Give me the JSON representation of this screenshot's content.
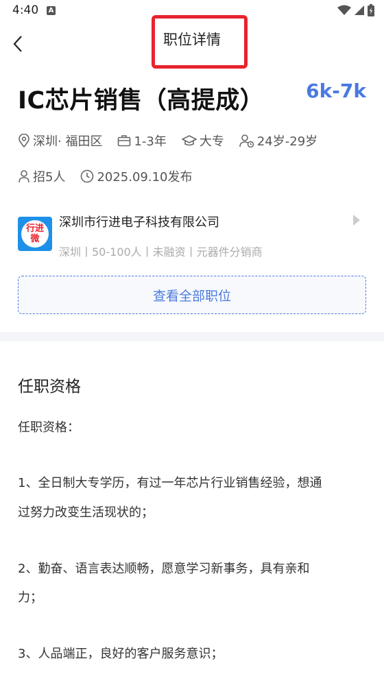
{
  "status": {
    "time": "4:40",
    "notif_letter": "A"
  },
  "nav": {
    "title": "职位详情"
  },
  "job": {
    "title": "IC芯片销售（高提成）",
    "salary": "6k-7k",
    "location": "深圳· 福田区",
    "experience": "1-3年",
    "education": "大专",
    "age": "24岁-29岁",
    "headcount": "招5人",
    "published": "2025.09.10发布"
  },
  "company": {
    "logo_text_1": "行进",
    "logo_text_2": "微",
    "name": "深圳市行进电子科技有限公司",
    "meta": "深圳丨50-100人丨未融资丨元器件分销商"
  },
  "all_jobs_label": "查看全部职位",
  "requirements": {
    "title": "任职资格",
    "lines": [
      "任职资格：",
      "1、全日制大专学历，有过一年芯片行业销售经验，想通",
      "过努力改变生活现状的；",
      "2、勤奋、语言表达顺畅，愿意学习新事务，具有亲和",
      "力；",
      "3、人品端正，良好的客户服务意识；"
    ]
  },
  "colors": {
    "accent": "#4a7ae0",
    "highlight_box": "#e8232e"
  }
}
